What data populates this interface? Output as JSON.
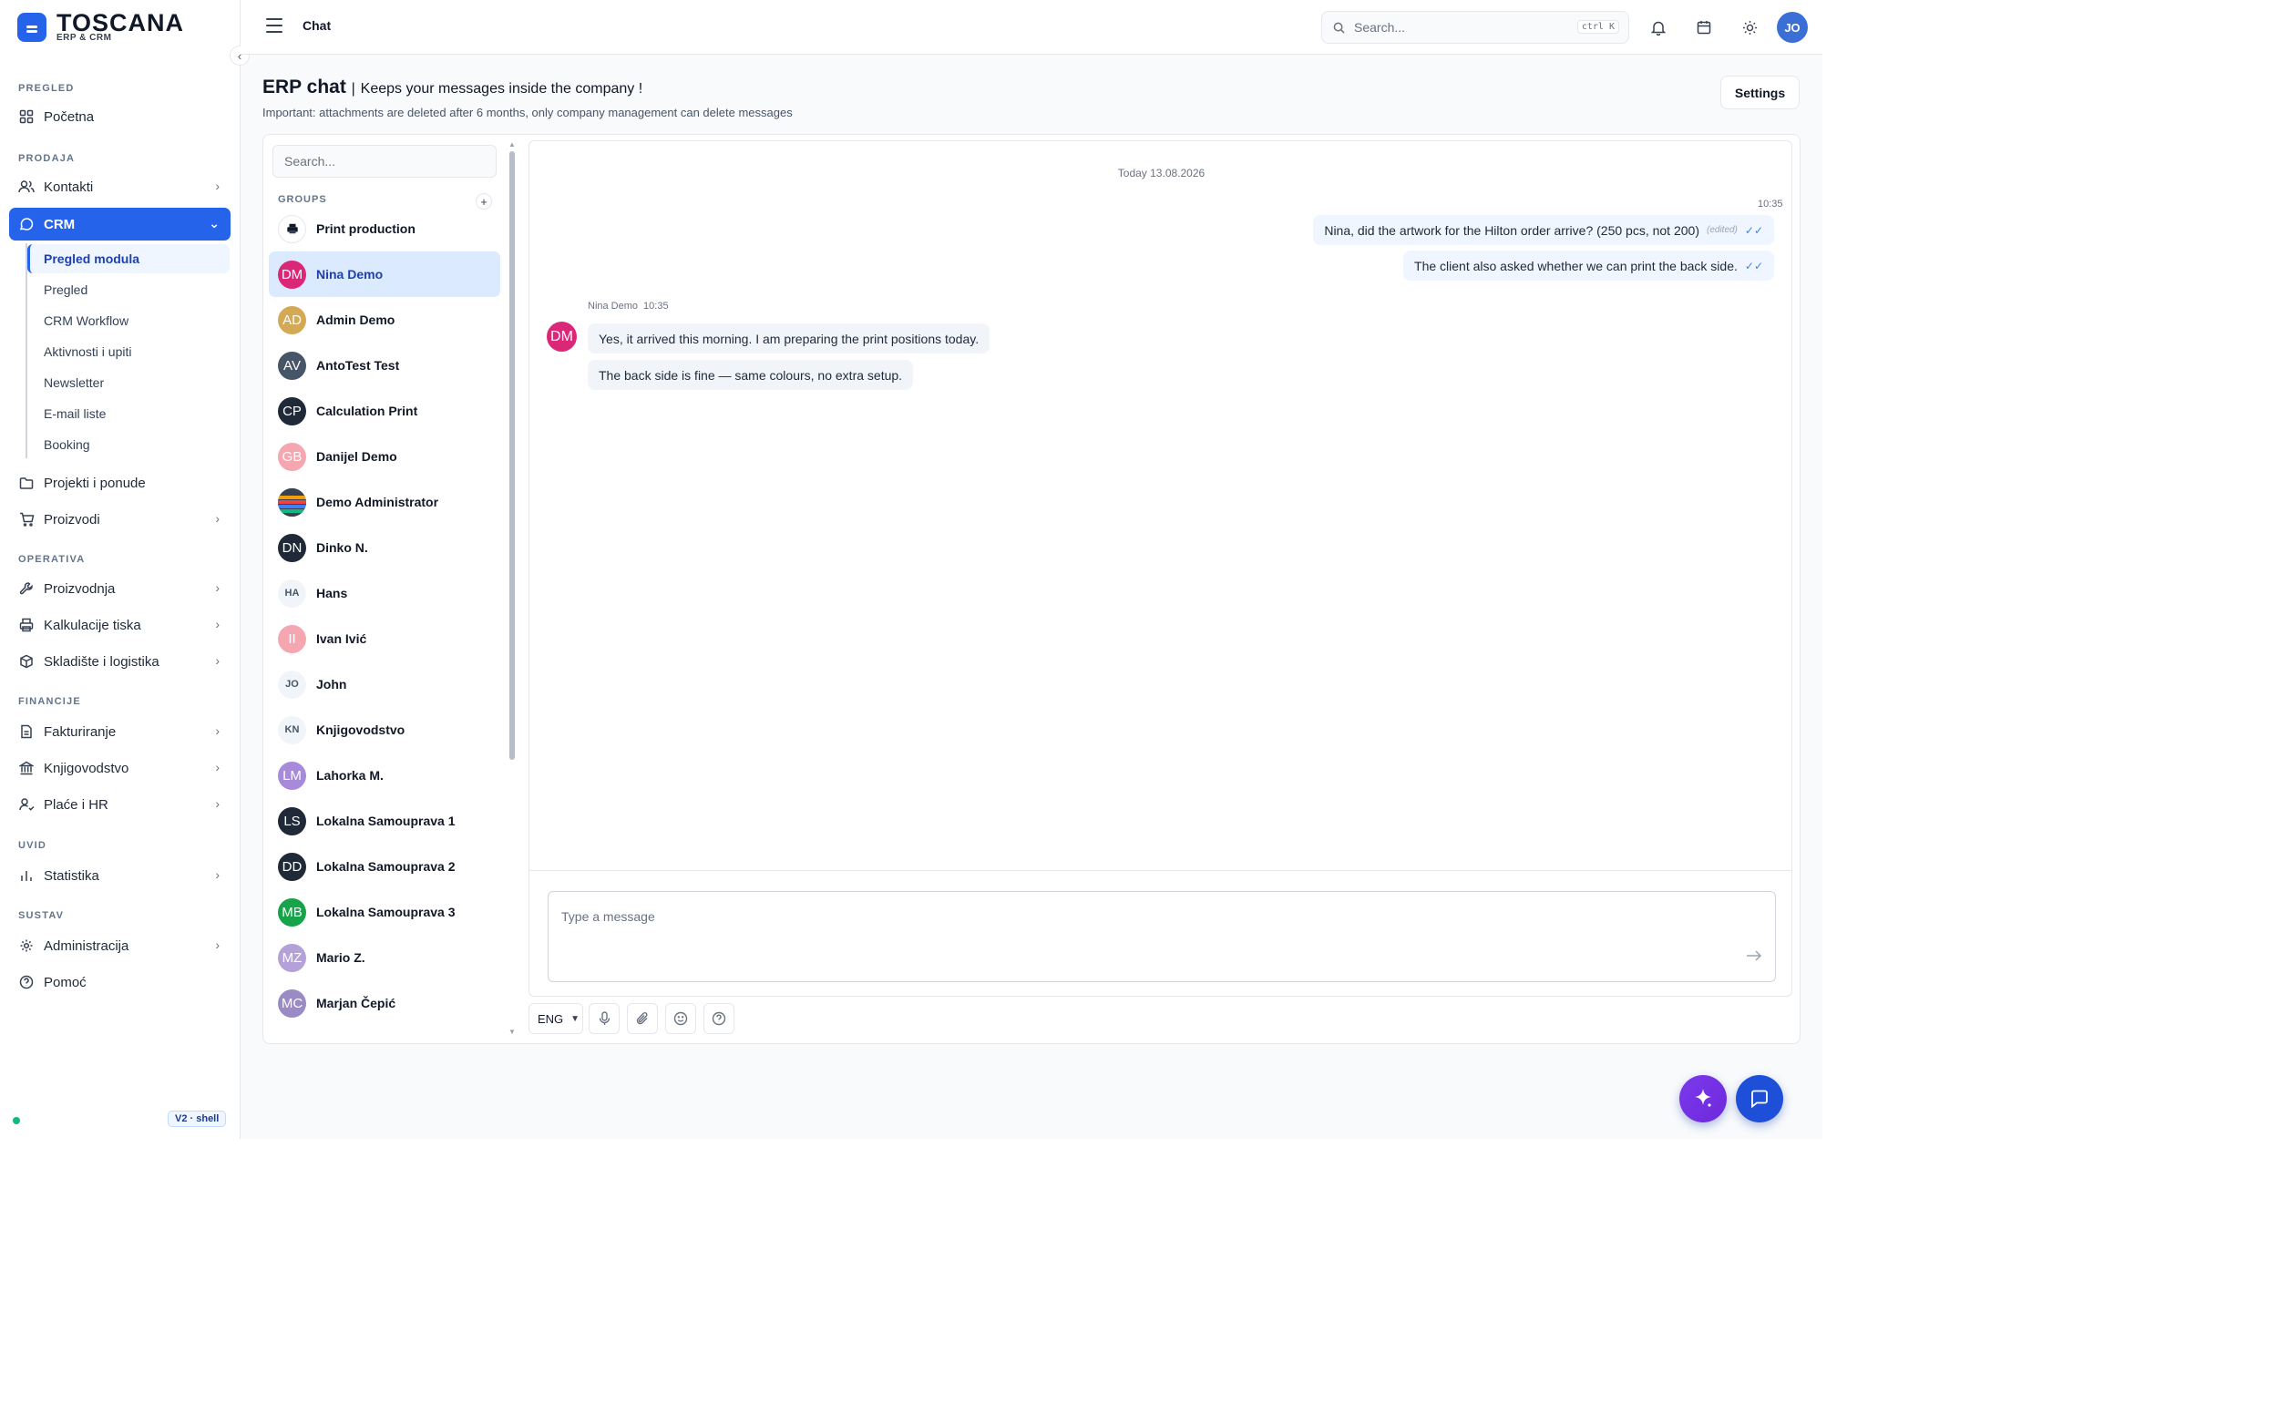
{
  "brand": {
    "name": "TOSCANA",
    "sub": "ERP & CRM"
  },
  "sidebar": {
    "sections": {
      "pregled": "PREGLED",
      "prodaja": "PRODAJA",
      "operativa": "OPERATIVA",
      "financije": "FINANCIJE",
      "uvid": "UVID",
      "sustav": "SUSTAV"
    },
    "items": {
      "pocetna": "Početna",
      "kontakti": "Kontakti",
      "crm": "CRM",
      "projekti": "Projekti i ponude",
      "proizvodi": "Proizvodi",
      "proizvodnja": "Proizvodnja",
      "kalkulacije": "Kalkulacije tiska",
      "skladiste": "Skladište i logistika",
      "fakturiranje": "Fakturiranje",
      "knjigovodstvo": "Knjigovodstvo",
      "place": "Plaće i HR",
      "statistika": "Statistika",
      "administracija": "Administracija",
      "pomoc": "Pomoć"
    },
    "crm_sub": [
      "Pregled modula",
      "Pregled",
      "CRM Workflow",
      "Aktivnosti i upiti",
      "Newsletter",
      "E-mail liste",
      "Booking"
    ],
    "version": "V2 · shell"
  },
  "topbar": {
    "title": "Chat",
    "search_placeholder": "Search...",
    "search_shortcut": "ctrl K",
    "user_initials": "JO"
  },
  "page": {
    "title": "ERP chat",
    "separator": "|",
    "tagline": "Keeps your messages inside the company !",
    "note": "Important: attachments are deleted after 6 months, only company management can delete messages",
    "settings_label": "Settings"
  },
  "contacts": {
    "search_placeholder": "Search...",
    "groups_label": "GROUPS",
    "add_label": "+",
    "list": [
      {
        "initials": "",
        "name": "Print production",
        "color": "#ffffff"
      },
      {
        "initials": "DM",
        "name": "Nina Demo",
        "color": "#db2777"
      },
      {
        "initials": "AD",
        "name": "Admin Demo",
        "color": "#d4a955"
      },
      {
        "initials": "AV",
        "name": "AntoTest Test",
        "color": "#475569"
      },
      {
        "initials": "CP",
        "name": "Calculation Print",
        "color": "#1f2937"
      },
      {
        "initials": "GB",
        "name": "Danijel Demo",
        "color": "#f4a7b1"
      },
      {
        "initials": "",
        "name": "Demo Administrator",
        "color": "#374151"
      },
      {
        "initials": "DN",
        "name": "Dinko N.",
        "color": "#1f2937"
      },
      {
        "initials": "HA",
        "name": "Hans",
        "color": "#f1f5f9"
      },
      {
        "initials": "II",
        "name": "Ivan Ivić",
        "color": "#f4a7b1"
      },
      {
        "initials": "JO",
        "name": "John",
        "color": "#f1f5f9"
      },
      {
        "initials": "KN",
        "name": "Knjigovodstvo",
        "color": "#f1f5f9"
      },
      {
        "initials": "LM",
        "name": "Lahorka M.",
        "color": "#a78bda"
      },
      {
        "initials": "LS",
        "name": "Lokalna Samouprava 1",
        "color": "#1f2937"
      },
      {
        "initials": "DD",
        "name": "Lokalna Samouprava 2",
        "color": "#1f2937"
      },
      {
        "initials": "MB",
        "name": "Lokalna Samouprava 3",
        "color": "#16a34a"
      },
      {
        "initials": "MZ",
        "name": "Mario Z.",
        "color": "#b4a1d8"
      },
      {
        "initials": "MC",
        "name": "Marjan Čepić",
        "color": "#9a8bc4"
      }
    ]
  },
  "conversation": {
    "date": "Today 13.08.2026",
    "outgoing_time": "10:35",
    "outgoing": [
      {
        "text": "Nina, did the artwork for the Hilton order arrive? (250 pcs, not 200)",
        "edited": "(edited)",
        "ticks": "✓✓"
      },
      {
        "text": "The client also asked whether we can print the back side.",
        "ticks": "✓✓"
      }
    ],
    "incoming_sender": "Nina Demo",
    "incoming_time": "10:35",
    "incoming_initials": "DM",
    "incoming": [
      "Yes, it arrived this morning. I am preparing the print positions today.",
      "The back side is fine — same colours, no extra setup."
    ],
    "composer_placeholder": "Type a message"
  },
  "toolbar": {
    "language": "ENG"
  },
  "colors": {
    "accent": "#2563eb",
    "online": "#10b981",
    "ai": "#7c3aed"
  }
}
